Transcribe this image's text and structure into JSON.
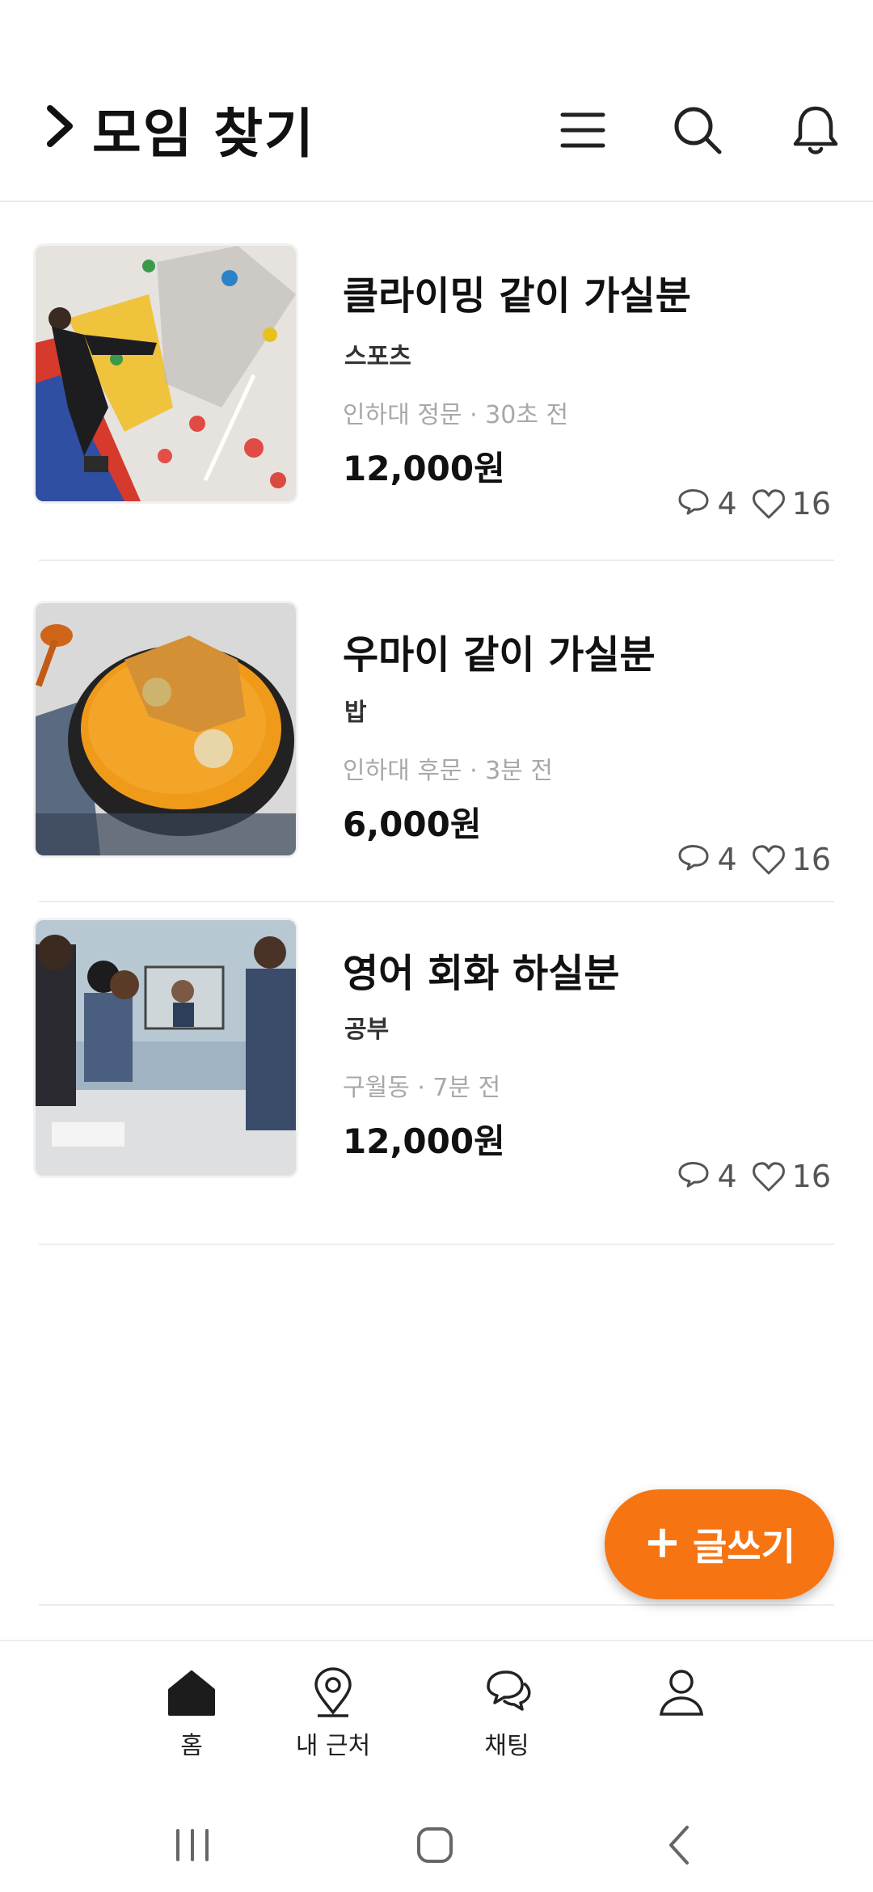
{
  "header": {
    "title": "모임 찾기",
    "icons": [
      "chevron-right-icon",
      "menu-icon",
      "search-icon",
      "bell-icon"
    ]
  },
  "posts": [
    {
      "title": "클라이밍 같이 가실분",
      "category": "스포츠",
      "meta": "인하대 정문 · 30초 전",
      "price": "12,000원",
      "comments": "4",
      "likes": "16"
    },
    {
      "title": "우마이 같이 가실분",
      "category": "밥",
      "meta": "인하대 후문 · 3분 전",
      "price": "6,000원",
      "comments": "4",
      "likes": "16"
    },
    {
      "title": "영어 회화 하실분",
      "category": "공부",
      "meta": "구월동 · 7분 전",
      "price": "12,000원",
      "comments": "4",
      "likes": "16"
    }
  ],
  "fab": {
    "plus": "+",
    "label": "글쓰기"
  },
  "bottom_nav": {
    "home": "홈",
    "nearby": "내 근처",
    "chat": "채팅"
  },
  "colors": {
    "accent": "#f77412",
    "text": "#111111",
    "muted": "#a8a8a8",
    "divider": "#ececec"
  }
}
